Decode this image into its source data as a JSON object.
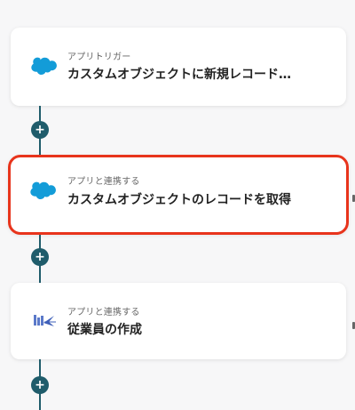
{
  "colors": {
    "accent": "#e8341c",
    "connector": "#1f5c6b",
    "salesforce": "#139cd8"
  },
  "steps": [
    {
      "subtitle": "アプリトリガー",
      "title": "カスタムオブジェクトに新規レコード…",
      "icon": "salesforce-cloud-icon"
    },
    {
      "subtitle": "アプリと連携する",
      "title": "カスタムオブジェクトのレコードを取得",
      "icon": "salesforce-cloud-icon",
      "selected": true
    },
    {
      "subtitle": "アプリと連携する",
      "title": "従業員の作成",
      "icon": "hr-app-icon"
    }
  ],
  "add_button": {
    "symbol": "+"
  }
}
